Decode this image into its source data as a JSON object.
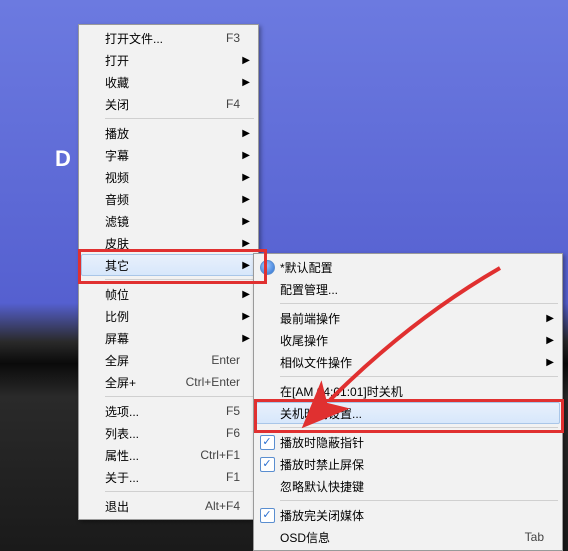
{
  "background": {
    "letter": "D"
  },
  "menu1": {
    "items": [
      {
        "label": "打开文件...",
        "shortcut": "F3",
        "sub": false,
        "sepAfter": false
      },
      {
        "label": "打开",
        "shortcut": "",
        "sub": true,
        "sepAfter": false
      },
      {
        "label": "收藏",
        "shortcut": "",
        "sub": true,
        "sepAfter": false
      },
      {
        "label": "关闭",
        "shortcut": "F4",
        "sub": false,
        "sepAfter": true
      },
      {
        "label": "播放",
        "shortcut": "",
        "sub": true,
        "sepAfter": false
      },
      {
        "label": "字幕",
        "shortcut": "",
        "sub": true,
        "sepAfter": false
      },
      {
        "label": "视频",
        "shortcut": "",
        "sub": true,
        "sepAfter": false
      },
      {
        "label": "音频",
        "shortcut": "",
        "sub": true,
        "sepAfter": false
      },
      {
        "label": "滤镜",
        "shortcut": "",
        "sub": true,
        "sepAfter": false
      },
      {
        "label": "皮肤",
        "shortcut": "",
        "sub": true,
        "sepAfter": false
      },
      {
        "label": "其它",
        "shortcut": "",
        "sub": true,
        "sepAfter": true,
        "hover": true
      },
      {
        "label": "帧位",
        "shortcut": "",
        "sub": true,
        "sepAfter": false
      },
      {
        "label": "比例",
        "shortcut": "",
        "sub": true,
        "sepAfter": false
      },
      {
        "label": "屏幕",
        "shortcut": "",
        "sub": true,
        "sepAfter": false
      },
      {
        "label": "全屏",
        "shortcut": "Enter",
        "sub": false,
        "sepAfter": false
      },
      {
        "label": "全屏+",
        "shortcut": "Ctrl+Enter",
        "sub": false,
        "sepAfter": true
      },
      {
        "label": "选项...",
        "shortcut": "F5",
        "sub": false,
        "sepAfter": false
      },
      {
        "label": "列表...",
        "shortcut": "F6",
        "sub": false,
        "sepAfter": false
      },
      {
        "label": "属性...",
        "shortcut": "Ctrl+F1",
        "sub": false,
        "sepAfter": false
      },
      {
        "label": "关于...",
        "shortcut": "F1",
        "sub": false,
        "sepAfter": true
      },
      {
        "label": "退出",
        "shortcut": "Alt+F4",
        "sub": false,
        "sepAfter": false
      }
    ]
  },
  "menu2": {
    "items": [
      {
        "label": "*默认配置",
        "check": "radio",
        "sepAfter": false
      },
      {
        "label": "配置管理...",
        "sepAfter": true
      },
      {
        "label": "最前端操作",
        "sub": true,
        "sepAfter": false
      },
      {
        "label": "收尾操作",
        "sub": true,
        "sepAfter": false
      },
      {
        "label": "相似文件操作",
        "sub": true,
        "sepAfter": true
      },
      {
        "label": "在[AM 04:01:01]时关机",
        "sepAfter": false
      },
      {
        "label": "关机时间设置...",
        "hover": true,
        "sepAfter": true
      },
      {
        "label": "播放时隐蔽指针",
        "check": "box",
        "sepAfter": false
      },
      {
        "label": "播放时禁止屏保",
        "check": "box",
        "sepAfter": false
      },
      {
        "label": "忽略默认快捷键",
        "sepAfter": true
      },
      {
        "label": "播放完关闭媒体",
        "check": "box",
        "sepAfter": false
      },
      {
        "label": "OSD信息",
        "shortcut": "Tab",
        "sepAfter": false
      }
    ]
  }
}
